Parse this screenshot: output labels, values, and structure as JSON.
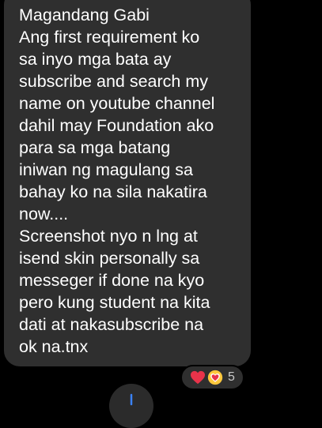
{
  "message": {
    "text": "Magandang Gabi\nAng first requirement ko\nsa inyo mga bata ay\nsubscribe and search my\nname on youtube channel\ndahil may Foundation ako\npara sa mga batang\niniwan ng magulang sa\nbahay ko na sila nakatira\nnow....\nScreenshot nyo n lng at\nisend skin personally sa\nmesseger if done na kyo\npero kung student na kita\ndati at nakasubscribe na\nok na.tnx"
  },
  "reactions": {
    "icons": [
      "heart-icon",
      "heart-face-icon"
    ],
    "count": "5"
  },
  "scroll_button": {
    "icon": "arrow-down-icon"
  },
  "colors": {
    "background": "#000000",
    "bubble": "#2f2f2f",
    "heart": "#e8334a"
  }
}
